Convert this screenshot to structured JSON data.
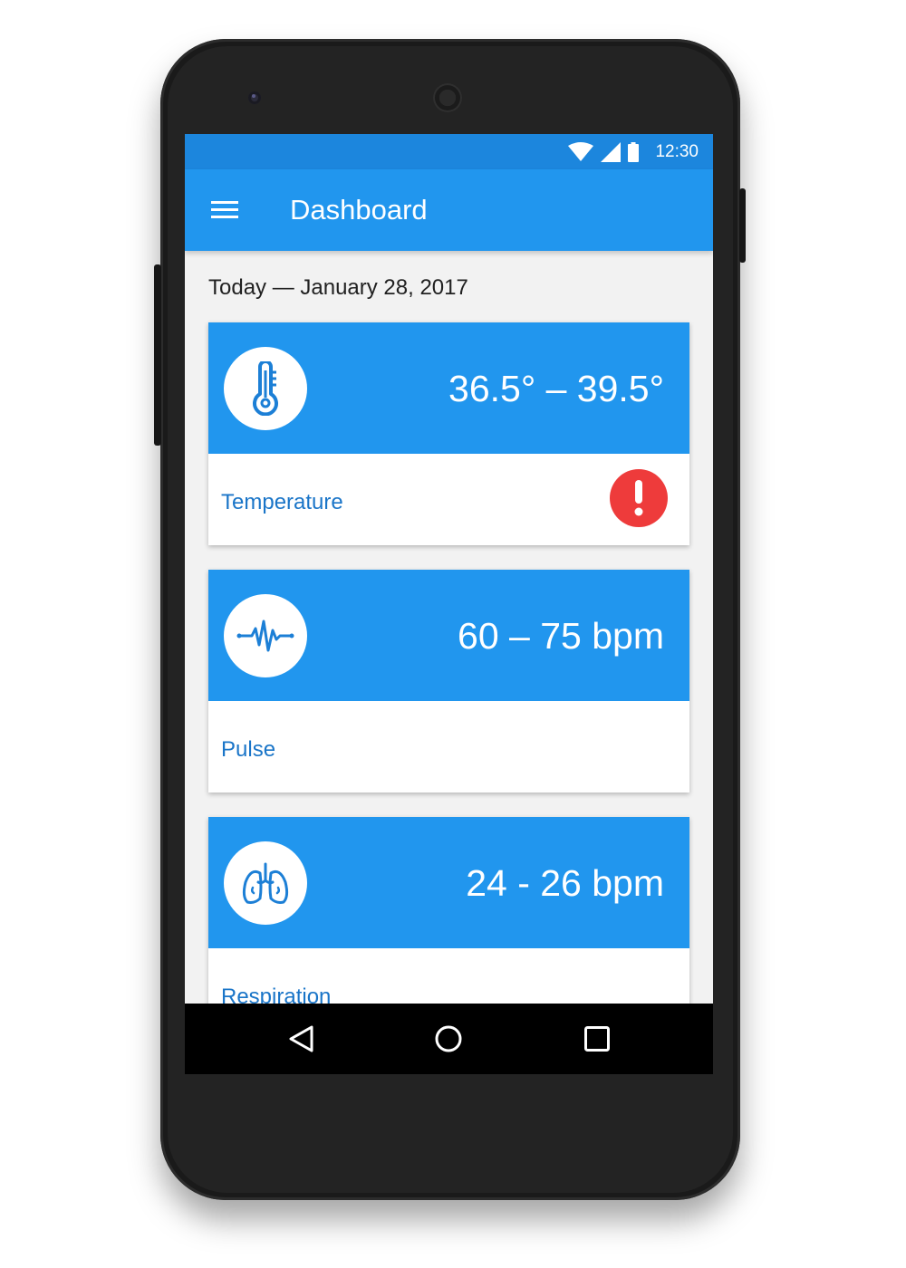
{
  "status_bar": {
    "time": "12:30",
    "icons": [
      "wifi-icon",
      "signal-icon",
      "battery-icon"
    ]
  },
  "app_bar": {
    "title": "Dashboard",
    "menu_icon": "menu-icon"
  },
  "date_label": "Today — January 28, 2017",
  "cards": [
    {
      "label": "Temperature",
      "value": "36.5° – 39.5°",
      "icon": "thermometer-icon",
      "alert": true,
      "alert_icon": "alert-icon"
    },
    {
      "label": "Pulse",
      "value": "60 – 75 bpm",
      "icon": "heartbeat-icon",
      "alert": false
    },
    {
      "label": "Respiration",
      "value": "24 - 26 bpm",
      "icon": "lungs-icon",
      "alert": false
    }
  ],
  "nav_bar": {
    "buttons": [
      "back-icon",
      "home-icon",
      "recents-icon"
    ]
  },
  "colors": {
    "primary": "#2196ee",
    "status_bar": "#1c86dd",
    "label_text": "#1a75c8",
    "alert": "#ee3b3b",
    "screen_background": "#f2f2f2"
  }
}
